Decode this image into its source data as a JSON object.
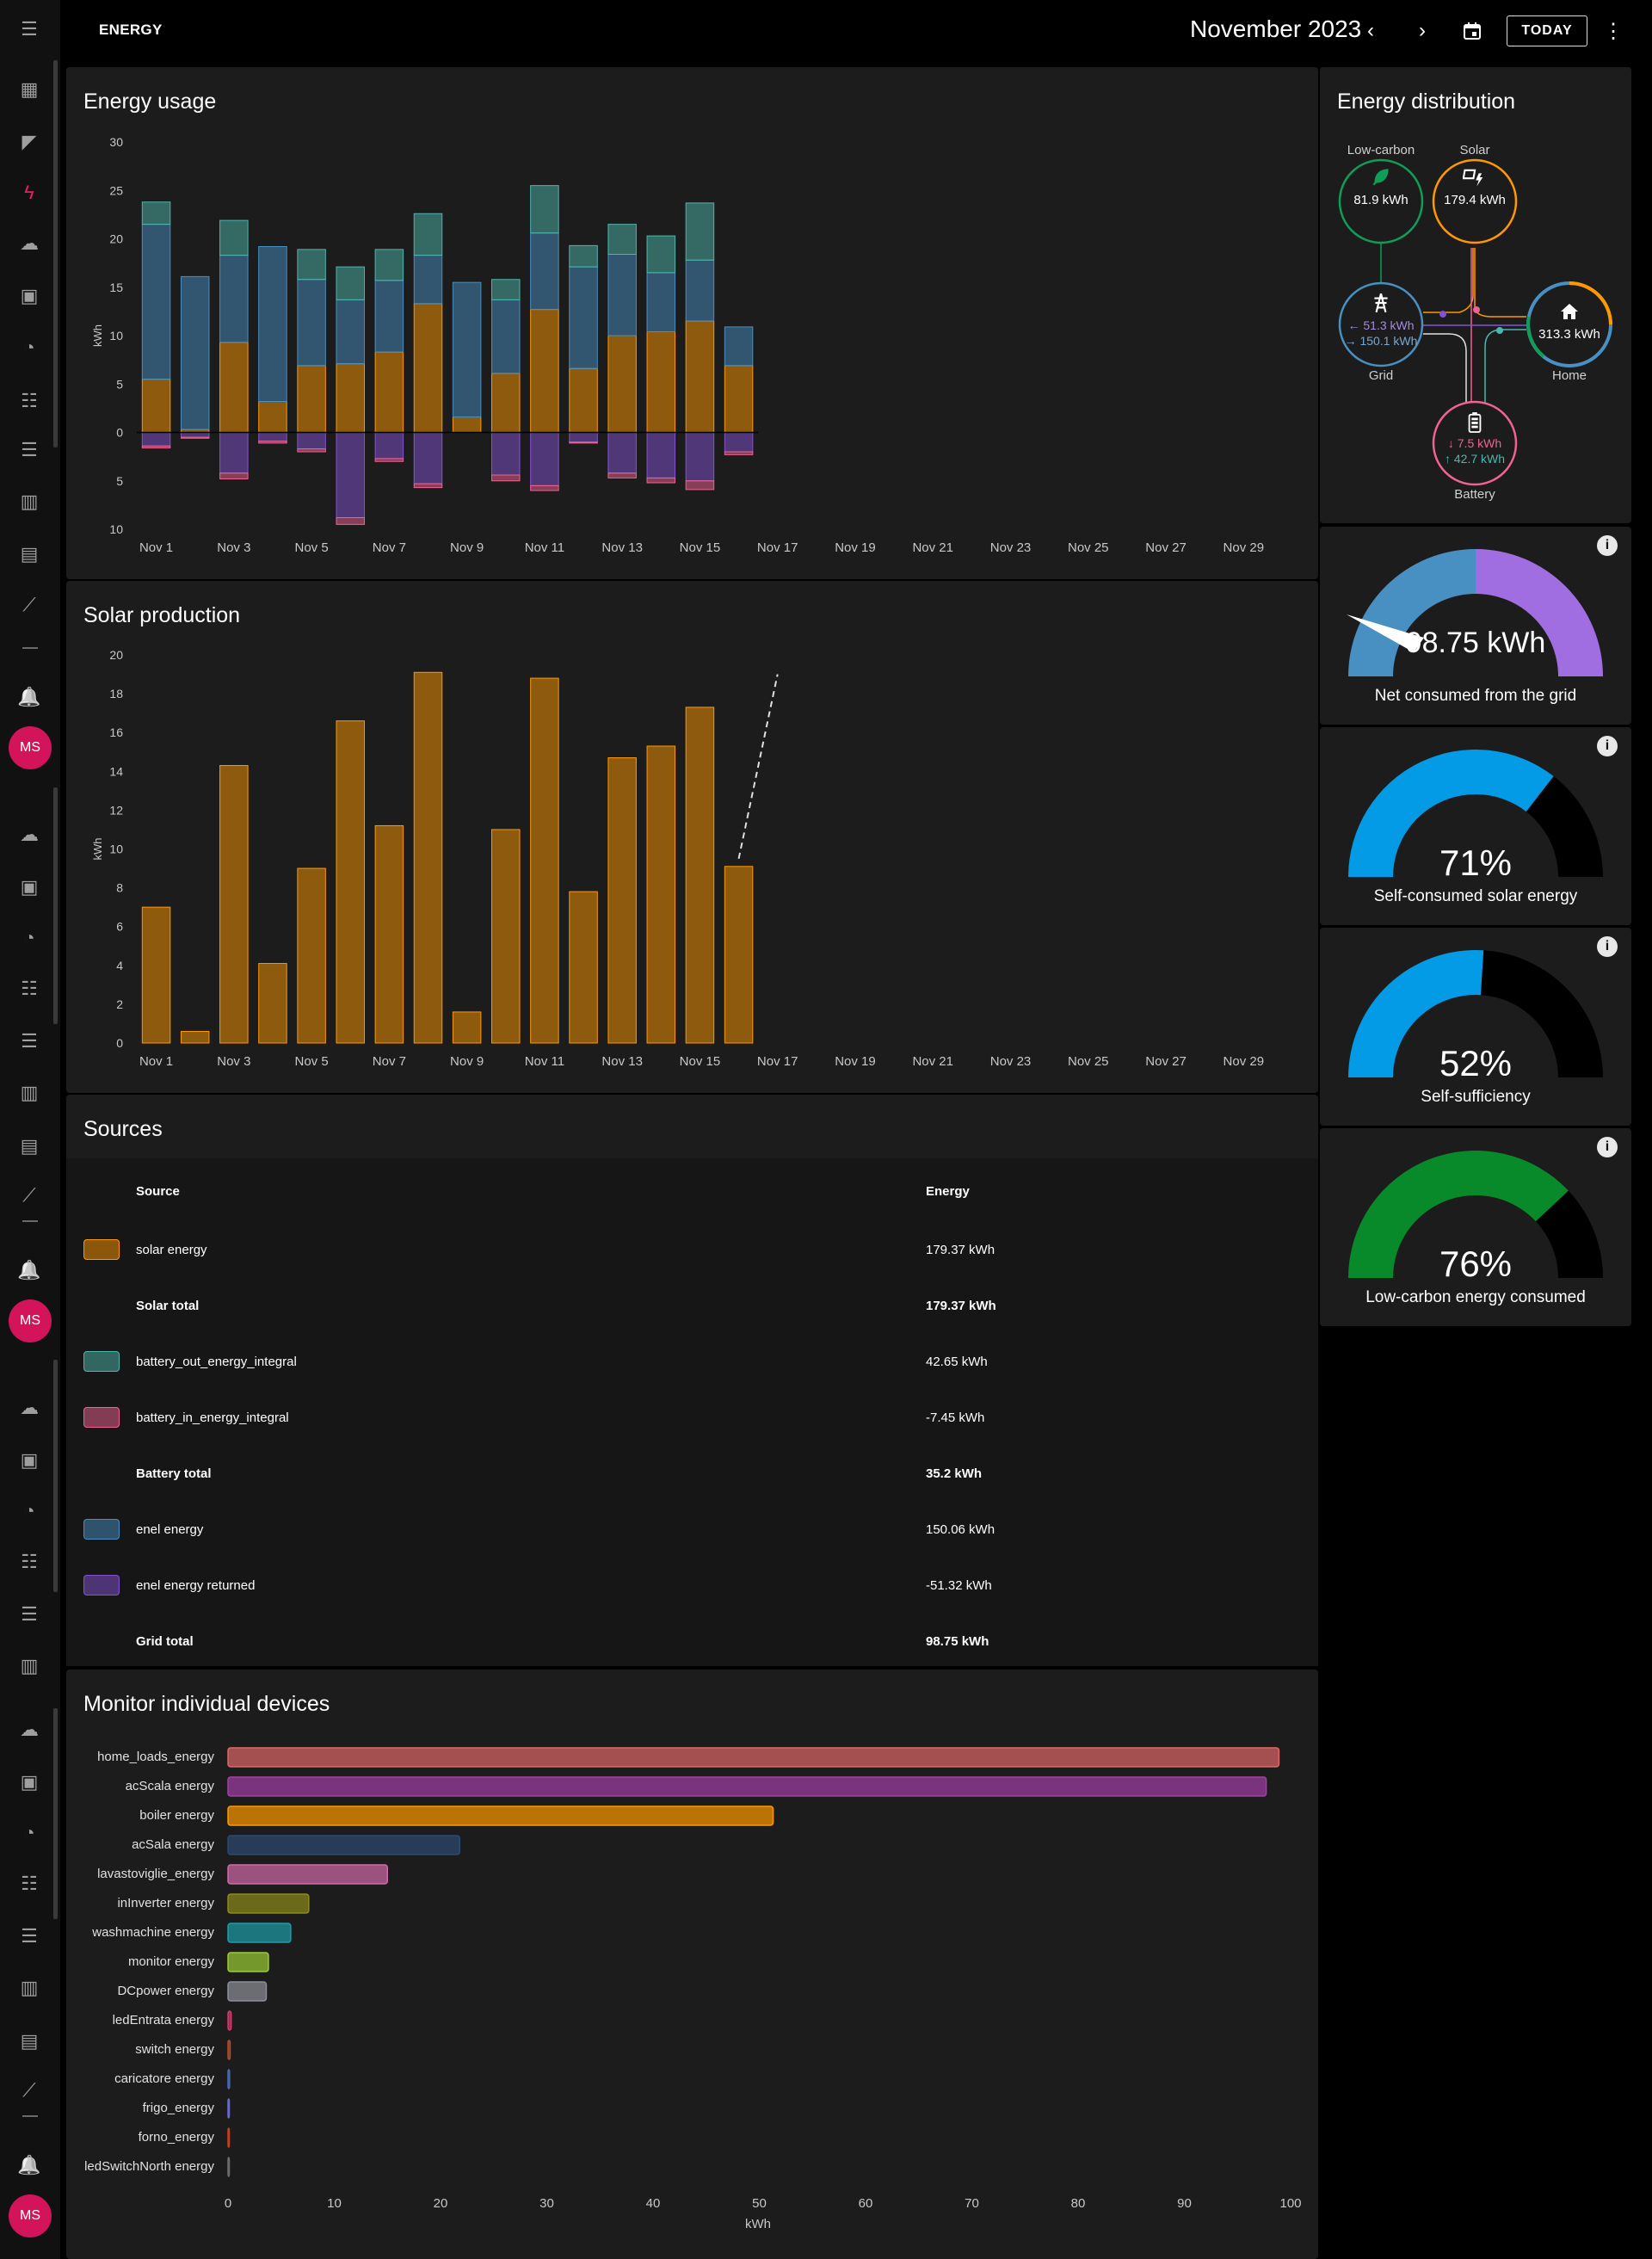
{
  "app": {
    "title": "ENERGY",
    "period": "November 2023",
    "today_label": "TODAY",
    "user_initials": "MS"
  },
  "colors": {
    "solar": "#ff9800",
    "battery_out": "#4db6ac",
    "battery_in": "#f06292",
    "grid_in": "#488fc2",
    "grid_out": "#8353d4",
    "low_carbon": "#0f9d58",
    "accent": "#e91e63"
  },
  "energy_usage": {
    "title": "Energy usage",
    "unit": "kWh"
  },
  "solar_production": {
    "title": "Solar production",
    "unit": "kWh"
  },
  "sources": {
    "title": "Sources",
    "col_source": "Source",
    "col_energy": "Energy",
    "rows": [
      {
        "label": "solar energy",
        "value": "179.37 kWh",
        "swatch": "solar"
      },
      {
        "label": "Solar total",
        "value": "179.37 kWh",
        "total": true
      },
      {
        "label": "battery_out_energy_integral",
        "value": "42.65 kWh",
        "swatch": "battery_out"
      },
      {
        "label": "battery_in_energy_integral",
        "value": "-7.45 kWh",
        "swatch": "battery_in"
      },
      {
        "label": "Battery total",
        "value": "35.2 kWh",
        "total": true
      },
      {
        "label": "enel energy",
        "value": "150.06 kWh",
        "swatch": "grid_in"
      },
      {
        "label": "enel energy returned",
        "value": "-51.32 kWh",
        "swatch": "grid_out"
      },
      {
        "label": "Grid total",
        "value": "98.75 kWh",
        "total": true
      }
    ]
  },
  "devices": {
    "title": "Monitor individual devices",
    "xlabel": "kWh"
  },
  "distribution": {
    "title": "Energy distribution",
    "low_carbon_label": "Low-carbon",
    "low_carbon_value": "81.9 kWh",
    "solar_label": "Solar",
    "solar_value": "179.4 kWh",
    "grid_label": "Grid",
    "grid_out_value": "← 51.3 kWh",
    "grid_in_value": "→ 150.1 kWh",
    "home_label": "Home",
    "home_value": "313.3 kWh",
    "battery_label": "Battery",
    "battery_in_value": "↓ 7.5 kWh",
    "battery_out_value": "↑ 42.7 kWh"
  },
  "gauges": [
    {
      "value": "98.75 kWh",
      "label": "Net consumed from the grid",
      "fraction": 0.0
    },
    {
      "value": "71%",
      "label": "Self-consumed solar energy",
      "fraction": 0.71
    },
    {
      "value": "52%",
      "label": "Self-sufficiency",
      "fraction": 0.52
    },
    {
      "value": "76%",
      "label": "Low-carbon energy consumed",
      "fraction": 0.76
    }
  ],
  "chart_data": [
    {
      "type": "bar",
      "title": "Energy usage",
      "ylabel": "kWh",
      "ylim": [
        -10,
        30
      ],
      "yticks": [
        30,
        25,
        20,
        15,
        10,
        5,
        0,
        5,
        10
      ],
      "x_tick_labels": [
        "Nov 1",
        "Nov 3",
        "Nov 5",
        "Nov 7",
        "Nov 9",
        "Nov 11",
        "Nov 13",
        "Nov 15",
        "Nov 17",
        "Nov 19",
        "Nov 21",
        "Nov 23",
        "Nov 25",
        "Nov 27",
        "Nov 29"
      ],
      "stacked": true,
      "series": [
        {
          "name": "solar energy",
          "color_key": "solar",
          "values": [
            5.5,
            0.3,
            9.3,
            3.2,
            6.9,
            7.1,
            8.3,
            13.3,
            1.6,
            6.1,
            12.7,
            6.6,
            10.0,
            10.4,
            11.5,
            6.9
          ]
        },
        {
          "name": "enel energy",
          "color_key": "grid_in",
          "values": [
            16,
            15.8,
            9.0,
            16,
            8.9,
            6.6,
            7.4,
            5.0,
            13.9,
            7.6,
            7.9,
            10.5,
            8.4,
            6.1,
            6.3,
            4.0
          ]
        },
        {
          "name": "battery_out_energy_integral",
          "color_key": "battery_out",
          "values": [
            2.3,
            0,
            3.6,
            0,
            3.1,
            3.4,
            3.2,
            4.3,
            0,
            2.1,
            4.9,
            2.2,
            3.1,
            3.8,
            5.9,
            0
          ]
        },
        {
          "name": "enel energy returned",
          "color_key": "grid_out",
          "values": [
            -1.4,
            -0.5,
            -4.2,
            -0.9,
            -1.7,
            -8.8,
            -2.7,
            -5.3,
            0,
            -4.4,
            -5.5,
            -1.0,
            -4.2,
            -4.7,
            -5.0,
            -2.0
          ]
        },
        {
          "name": "battery_in_energy_integral",
          "color_key": "battery_in",
          "values": [
            -0.2,
            -0.1,
            -0.6,
            -0.2,
            -0.3,
            -0.7,
            -0.3,
            -0.4,
            0,
            -0.6,
            -0.5,
            -0.1,
            -0.5,
            -0.5,
            -0.9,
            -0.3
          ]
        }
      ],
      "days": 30
    },
    {
      "type": "bar",
      "title": "Solar production",
      "ylabel": "kWh",
      "ylim": [
        0,
        20
      ],
      "yticks": [
        20,
        18,
        16,
        14,
        12,
        10,
        8,
        6,
        4,
        2,
        0
      ],
      "x_tick_labels": [
        "Nov 1",
        "Nov 3",
        "Nov 5",
        "Nov 7",
        "Nov 9",
        "Nov 11",
        "Nov 13",
        "Nov 15",
        "Nov 17",
        "Nov 19",
        "Nov 21",
        "Nov 23",
        "Nov 25",
        "Nov 27",
        "Nov 29"
      ],
      "series": [
        {
          "name": "solar energy",
          "color_key": "solar",
          "values": [
            7.0,
            0.6,
            14.3,
            4.1,
            9.0,
            16.6,
            11.2,
            19.1,
            1.6,
            11.0,
            18.8,
            7.8,
            14.7,
            15.3,
            17.3,
            9.1
          ]
        }
      ],
      "forecast": {
        "from": [
          16,
          9.5
        ],
        "to": [
          17,
          19.0
        ]
      },
      "days": 30
    },
    {
      "type": "bar",
      "orientation": "horizontal",
      "title": "Monitor individual devices",
      "xlabel": "kWh",
      "xlim": [
        0,
        100
      ],
      "xticks": [
        0,
        10,
        20,
        30,
        40,
        50,
        60,
        70,
        80,
        90,
        100
      ],
      "categories": [
        "home_loads_energy",
        "acScala energy",
        "boiler energy",
        "acSala energy",
        "lavastoviglie_energy",
        "inInverter energy",
        "washmachine energy",
        "monitor energy",
        "DCpower energy",
        "ledEntrata energy",
        "switch energy",
        "caricatore energy",
        "frigo_energy",
        "forno_energy",
        "ledSwitchNorth energy"
      ],
      "values": [
        98.9,
        97.7,
        51.3,
        21.8,
        15.0,
        7.6,
        5.9,
        3.8,
        3.6,
        0.3,
        0.2,
        0.15,
        0.1,
        0.1,
        0.05
      ],
      "colors": [
        "#e06666",
        "#a33fa8",
        "#ff9800",
        "#2c4a73",
        "#d16aa8",
        "#8b8b1a",
        "#1b9da8",
        "#9acd32",
        "#8e8e99",
        "#d13a6b",
        "#b24c2a",
        "#4a6bb5",
        "#6a6acd",
        "#c04020",
        "#6c6c6c"
      ]
    }
  ]
}
